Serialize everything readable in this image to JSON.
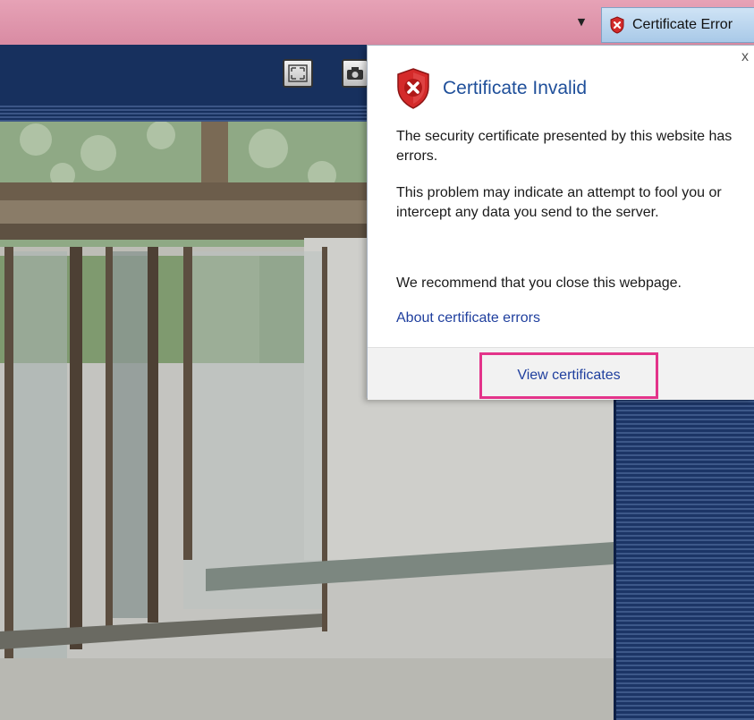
{
  "addressbar": {
    "dropdown_glyph": "▼",
    "certificate_button": {
      "label": "Certificate Error",
      "icon": "shield-error-icon"
    }
  },
  "toolbar": {
    "fullscreen_icon": "fullscreen-icon",
    "snapshot_icon": "camera-icon"
  },
  "popup": {
    "close_glyph": "x",
    "title": "Certificate Invalid",
    "icon": "shield-error-icon",
    "paragraphs": [
      "The security certificate presented by this website has errors.",
      "This problem may indicate an attempt to fool you or intercept any data you send to the server.",
      "We recommend that you close this webpage."
    ],
    "link_label": "About certificate errors",
    "view_certificates_label": "View certificates"
  },
  "colors": {
    "address_bar": "#d98ba3",
    "toolbar": "#17305e",
    "title": "#1f4f9a",
    "link": "#1f3f9e",
    "highlight": "#e3348a"
  }
}
